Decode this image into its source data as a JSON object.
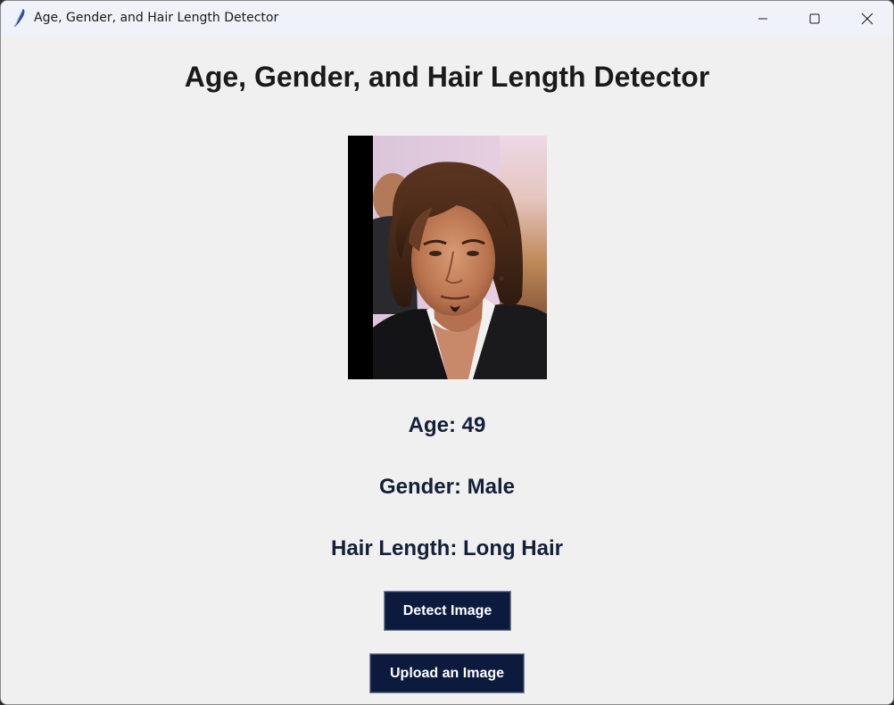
{
  "window": {
    "title": "Age, Gender, and Hair Length Detector",
    "app_icon": "feather-icon",
    "controls": [
      "minimize-icon",
      "maximize-icon",
      "close-icon"
    ]
  },
  "main": {
    "heading": "Age, Gender, and Hair Length Detector",
    "photo": {
      "description_icon": "uploaded-photo"
    },
    "results": {
      "age": "Age: 49",
      "gender": "Gender: Male",
      "hair_length": "Hair Length: Long Hair"
    },
    "buttons": {
      "detect_label": "Detect Image",
      "upload_label": "Upload an Image"
    }
  },
  "colors": {
    "background": "#f0f0f0",
    "titlebar": "#eff2f9",
    "button_bg": "#0b1a3d",
    "button_text": "#ffffff",
    "result_text": "#142038"
  }
}
